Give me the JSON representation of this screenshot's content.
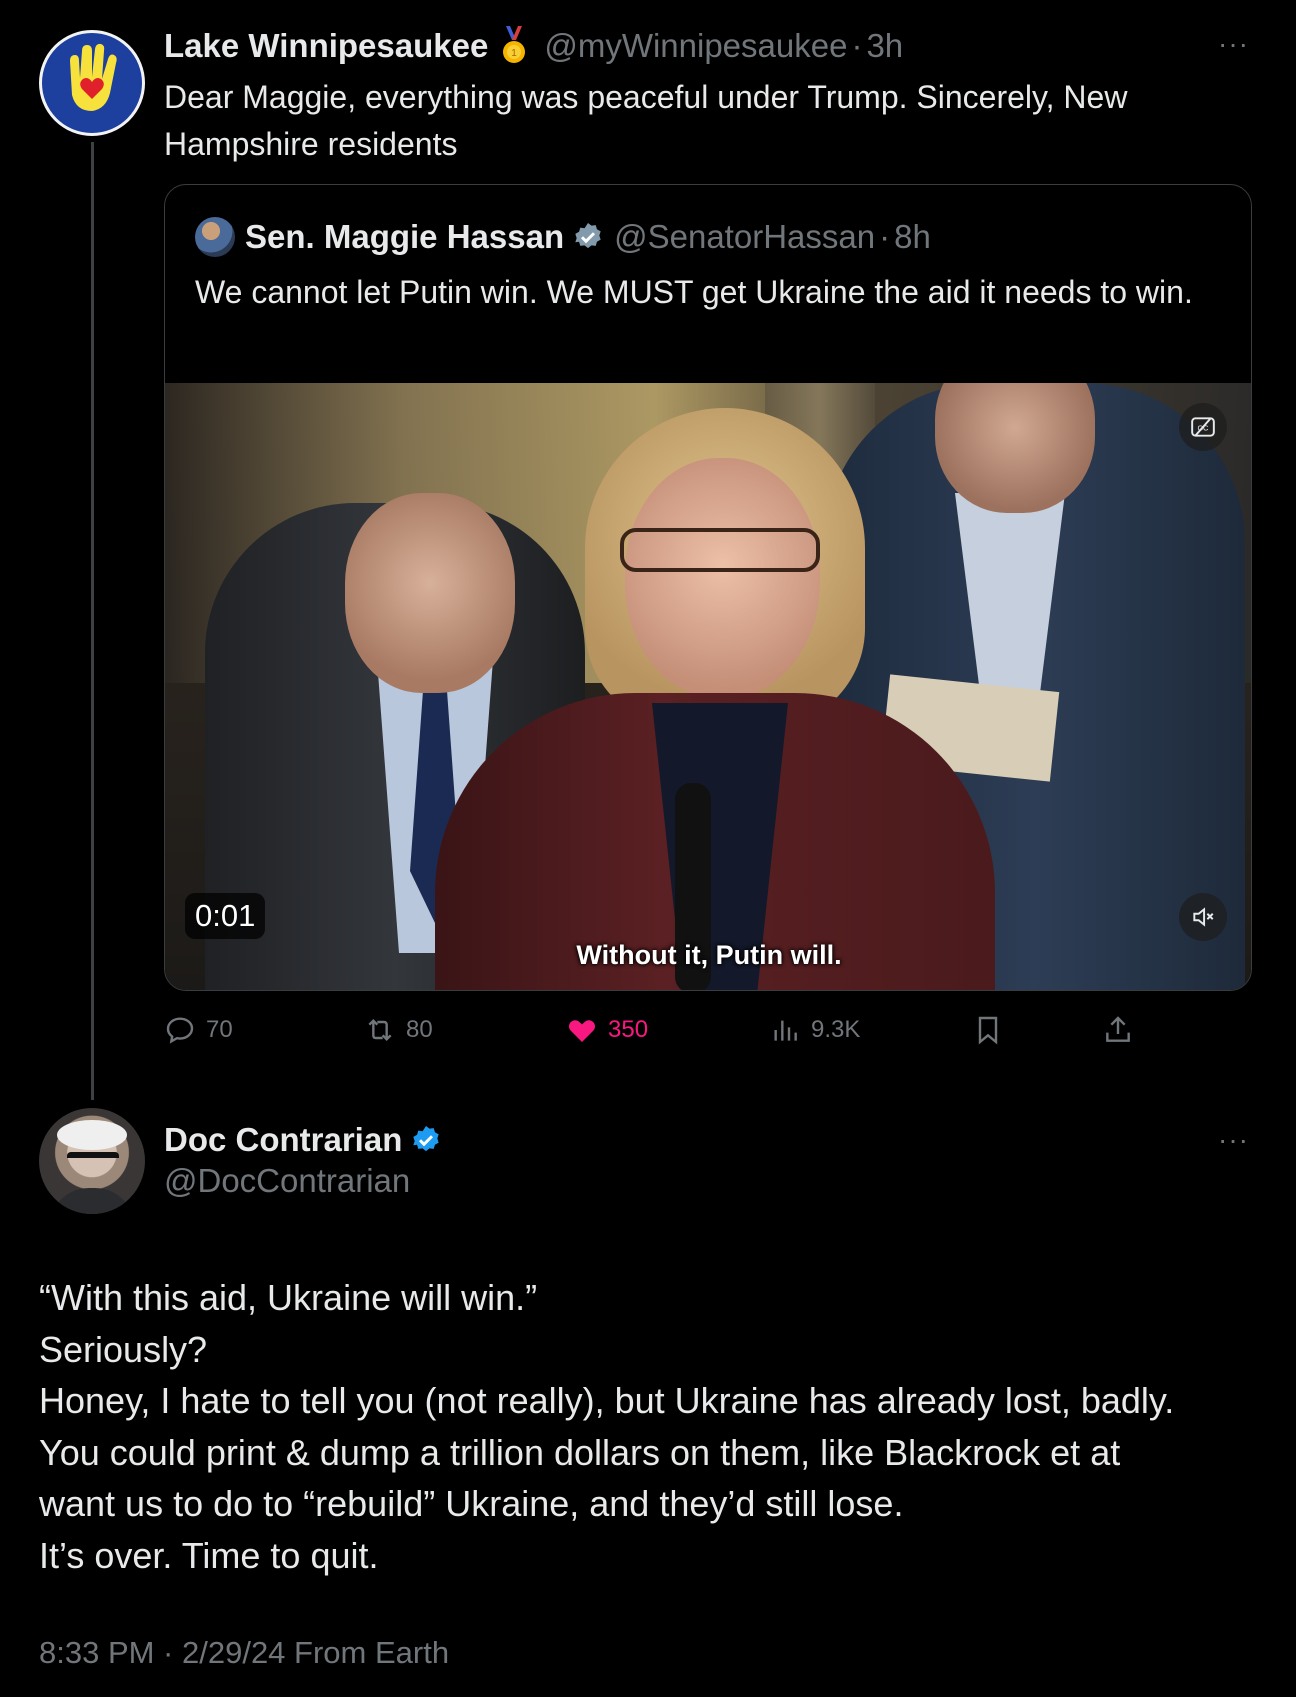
{
  "tweet1": {
    "author_name": "Lake Winnipesaukee",
    "handle": "@myWinnipesaukee",
    "separator": "·",
    "time": "3h",
    "more_label": "···",
    "text": "Dear Maggie, everything was peaceful under Trump. Sincerely,  New Hampshire residents",
    "avatar_text": "Lake Winnipesaukee",
    "quote": {
      "author_name": "Sen. Maggie Hassan",
      "handle": "@SenatorHassan",
      "separator": "·",
      "time": "8h",
      "text": "We cannot let Putin win. We MUST get Ukraine the aid it needs to win.",
      "video": {
        "time_label": "0:01",
        "caption": "Without it, Putin will."
      }
    },
    "actions": {
      "replies": "70",
      "reposts": "80",
      "likes": "350",
      "views": "9.3K"
    }
  },
  "tweet2": {
    "author_name": "Doc Contrarian",
    "handle": "@DocContrarian",
    "more_label": "···",
    "lines": [
      "“With this aid, Ukraine will win.”",
      "Seriously?",
      "Honey, I hate to tell you (not really), but Ukraine has already lost, badly.",
      "You could print & dump a trillion dollars on them, like Blackrock et at",
      "want us to do to “rebuild” Ukraine, and they’d still lose.",
      "It’s over. Time to quit."
    ],
    "meta": "8:33 PM · 2/29/24 From Earth"
  },
  "colors": {
    "background": "#000000",
    "text": "#e7e9ea",
    "muted": "#71767b",
    "like": "#f91880",
    "verified": "#1d9bf0"
  },
  "icons": [
    "reply-icon",
    "repost-icon",
    "like-icon",
    "views-icon",
    "bookmark-icon",
    "share-icon",
    "verified-badge-icon",
    "medal-icon",
    "captions-icon",
    "mute-icon"
  ]
}
